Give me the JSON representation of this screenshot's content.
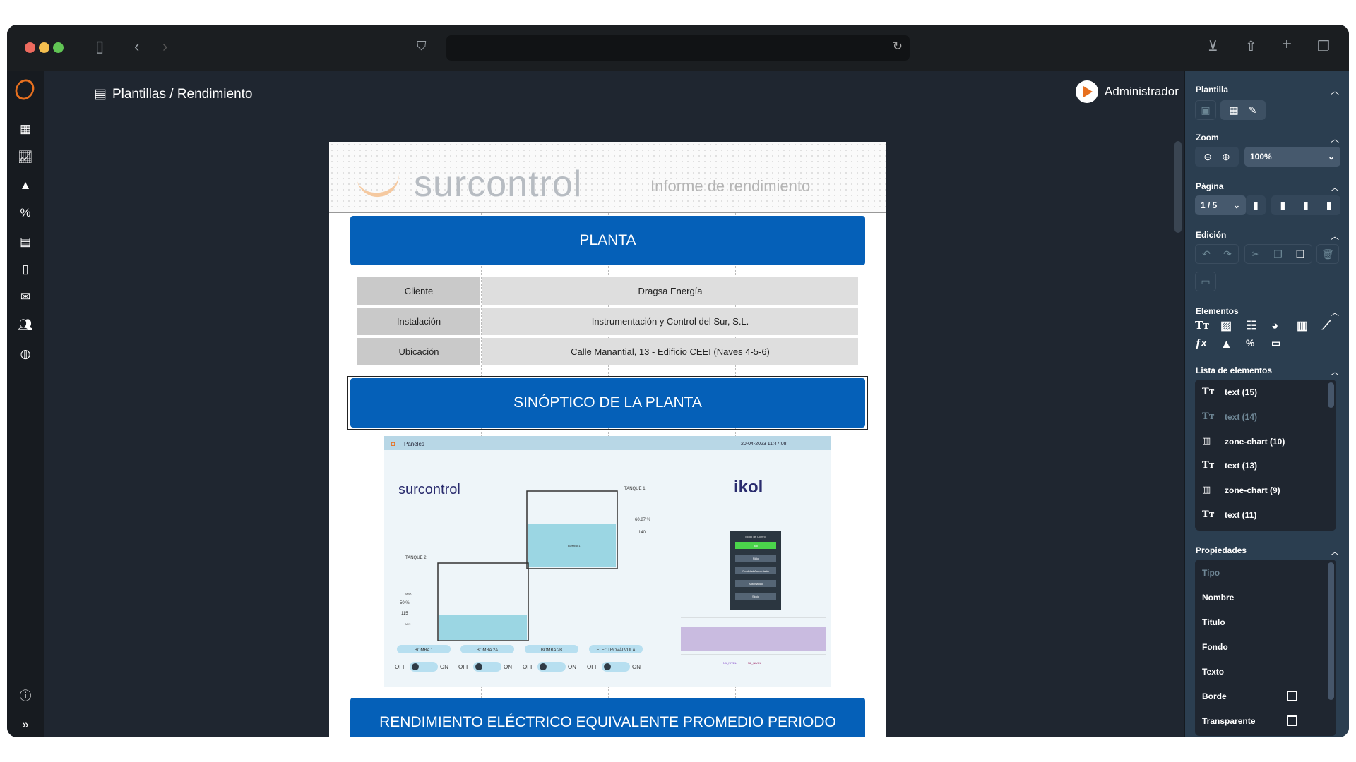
{
  "browser": {
    "icons": [
      "sidebar-toggle-icon",
      "back-icon",
      "forward-icon",
      "shield-icon",
      "reload-icon",
      "download-icon",
      "share-icon",
      "new-tab-icon",
      "tabs-icon"
    ]
  },
  "header": {
    "breadcrumb": "Plantillas / Rendimiento",
    "user": "Administrador"
  },
  "rail": {
    "items": [
      "dashboard",
      "charts",
      "alerts",
      "percent",
      "reports",
      "documents",
      "comments",
      "users",
      "globe"
    ],
    "bottom": [
      "info",
      "expand"
    ]
  },
  "page": {
    "logo": "surcontrol",
    "report_title": "Informe de rendimiento",
    "section1": "PLANTA",
    "table": [
      {
        "label": "Cliente",
        "value": "Dragsa Energía"
      },
      {
        "label": "Instalación",
        "value": "Instrumentación y Control del Sur, S.L."
      },
      {
        "label": "Ubicación",
        "value": "Calle Manantial, 13 - Edificio CEEI (Naves 4-5-6)"
      }
    ],
    "section2": "SINÓPTICO DE LA PLANTA",
    "section3": "RENDIMIENTO ELÉCTRICO EQUIVALENTE PROMEDIO PERIODO",
    "synoptic": {
      "nav": "Paneles",
      "datetime": "20-04-2023 11:47:08",
      "logo1": "surcontrol",
      "logo2": "ikol",
      "tank1": "TANQUE 1",
      "tank2": "TANQUE 2",
      "max": "MAX",
      "min": "MIN",
      "tank1_pct": "60.87 %",
      "tank1_val": "140",
      "tank2_pct": "50 %",
      "tank2_val": "115",
      "pump_small": "BOMBA 1",
      "zero": "0",
      "mode_title": "Modo de Control",
      "modes": [
        "Ikol",
        "Nido",
        "Realidad Aumentada",
        "Automático",
        "Skuid"
      ],
      "switches": [
        "BOMBA 1",
        "BOMBA 2A",
        "BOMBA 2B",
        "ELECTROVÁLVULA"
      ],
      "off": "OFF",
      "on": "ON",
      "legend": [
        "N1_NIVEL",
        "N2_NIVEL"
      ]
    }
  },
  "panel": {
    "plantilla": "Plantilla",
    "zoom": "Zoom",
    "zoom_value": "100%",
    "pagina": "Página",
    "page_value": "1 / 5",
    "edicion": "Edición",
    "elementos": "Elementos",
    "lista": "Lista de elementos",
    "propiedades": "Propiedades",
    "list": [
      {
        "icon": "text-icon",
        "label": "text (15)"
      },
      {
        "icon": "text-icon",
        "label": "text (14)"
      },
      {
        "icon": "bar-chart-icon",
        "label": "zone-chart (10)"
      },
      {
        "icon": "text-icon",
        "label": "text (13)"
      },
      {
        "icon": "bar-chart-icon",
        "label": "zone-chart (9)"
      },
      {
        "icon": "text-icon",
        "label": "text (11)"
      }
    ],
    "props": [
      "Tipo",
      "Nombre",
      "Título",
      "Fondo",
      "Texto",
      "Borde",
      "Transparente"
    ],
    "borde_checked": false,
    "transparente_checked": false
  },
  "colors": {
    "accent": "#0560b8",
    "brand": "#e7701f",
    "panel": "#2b3e50"
  }
}
